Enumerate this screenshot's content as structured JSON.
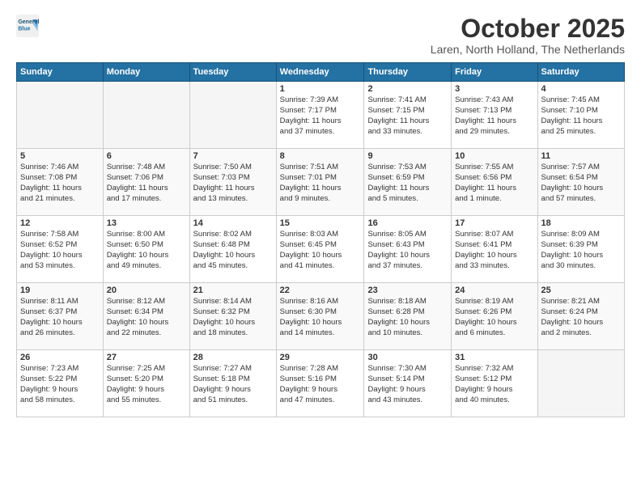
{
  "header": {
    "logo_line1": "General",
    "logo_line2": "Blue",
    "title": "October 2025",
    "subtitle": "Laren, North Holland, The Netherlands"
  },
  "days_of_week": [
    "Sunday",
    "Monday",
    "Tuesday",
    "Wednesday",
    "Thursday",
    "Friday",
    "Saturday"
  ],
  "weeks": [
    [
      {
        "day": "",
        "info": ""
      },
      {
        "day": "",
        "info": ""
      },
      {
        "day": "",
        "info": ""
      },
      {
        "day": "1",
        "info": "Sunrise: 7:39 AM\nSunset: 7:17 PM\nDaylight: 11 hours\nand 37 minutes."
      },
      {
        "day": "2",
        "info": "Sunrise: 7:41 AM\nSunset: 7:15 PM\nDaylight: 11 hours\nand 33 minutes."
      },
      {
        "day": "3",
        "info": "Sunrise: 7:43 AM\nSunset: 7:13 PM\nDaylight: 11 hours\nand 29 minutes."
      },
      {
        "day": "4",
        "info": "Sunrise: 7:45 AM\nSunset: 7:10 PM\nDaylight: 11 hours\nand 25 minutes."
      }
    ],
    [
      {
        "day": "5",
        "info": "Sunrise: 7:46 AM\nSunset: 7:08 PM\nDaylight: 11 hours\nand 21 minutes."
      },
      {
        "day": "6",
        "info": "Sunrise: 7:48 AM\nSunset: 7:06 PM\nDaylight: 11 hours\nand 17 minutes."
      },
      {
        "day": "7",
        "info": "Sunrise: 7:50 AM\nSunset: 7:03 PM\nDaylight: 11 hours\nand 13 minutes."
      },
      {
        "day": "8",
        "info": "Sunrise: 7:51 AM\nSunset: 7:01 PM\nDaylight: 11 hours\nand 9 minutes."
      },
      {
        "day": "9",
        "info": "Sunrise: 7:53 AM\nSunset: 6:59 PM\nDaylight: 11 hours\nand 5 minutes."
      },
      {
        "day": "10",
        "info": "Sunrise: 7:55 AM\nSunset: 6:56 PM\nDaylight: 11 hours\nand 1 minute."
      },
      {
        "day": "11",
        "info": "Sunrise: 7:57 AM\nSunset: 6:54 PM\nDaylight: 10 hours\nand 57 minutes."
      }
    ],
    [
      {
        "day": "12",
        "info": "Sunrise: 7:58 AM\nSunset: 6:52 PM\nDaylight: 10 hours\nand 53 minutes."
      },
      {
        "day": "13",
        "info": "Sunrise: 8:00 AM\nSunset: 6:50 PM\nDaylight: 10 hours\nand 49 minutes."
      },
      {
        "day": "14",
        "info": "Sunrise: 8:02 AM\nSunset: 6:48 PM\nDaylight: 10 hours\nand 45 minutes."
      },
      {
        "day": "15",
        "info": "Sunrise: 8:03 AM\nSunset: 6:45 PM\nDaylight: 10 hours\nand 41 minutes."
      },
      {
        "day": "16",
        "info": "Sunrise: 8:05 AM\nSunset: 6:43 PM\nDaylight: 10 hours\nand 37 minutes."
      },
      {
        "day": "17",
        "info": "Sunrise: 8:07 AM\nSunset: 6:41 PM\nDaylight: 10 hours\nand 33 minutes."
      },
      {
        "day": "18",
        "info": "Sunrise: 8:09 AM\nSunset: 6:39 PM\nDaylight: 10 hours\nand 30 minutes."
      }
    ],
    [
      {
        "day": "19",
        "info": "Sunrise: 8:11 AM\nSunset: 6:37 PM\nDaylight: 10 hours\nand 26 minutes."
      },
      {
        "day": "20",
        "info": "Sunrise: 8:12 AM\nSunset: 6:34 PM\nDaylight: 10 hours\nand 22 minutes."
      },
      {
        "day": "21",
        "info": "Sunrise: 8:14 AM\nSunset: 6:32 PM\nDaylight: 10 hours\nand 18 minutes."
      },
      {
        "day": "22",
        "info": "Sunrise: 8:16 AM\nSunset: 6:30 PM\nDaylight: 10 hours\nand 14 minutes."
      },
      {
        "day": "23",
        "info": "Sunrise: 8:18 AM\nSunset: 6:28 PM\nDaylight: 10 hours\nand 10 minutes."
      },
      {
        "day": "24",
        "info": "Sunrise: 8:19 AM\nSunset: 6:26 PM\nDaylight: 10 hours\nand 6 minutes."
      },
      {
        "day": "25",
        "info": "Sunrise: 8:21 AM\nSunset: 6:24 PM\nDaylight: 10 hours\nand 2 minutes."
      }
    ],
    [
      {
        "day": "26",
        "info": "Sunrise: 7:23 AM\nSunset: 5:22 PM\nDaylight: 9 hours\nand 58 minutes."
      },
      {
        "day": "27",
        "info": "Sunrise: 7:25 AM\nSunset: 5:20 PM\nDaylight: 9 hours\nand 55 minutes."
      },
      {
        "day": "28",
        "info": "Sunrise: 7:27 AM\nSunset: 5:18 PM\nDaylight: 9 hours\nand 51 minutes."
      },
      {
        "day": "29",
        "info": "Sunrise: 7:28 AM\nSunset: 5:16 PM\nDaylight: 9 hours\nand 47 minutes."
      },
      {
        "day": "30",
        "info": "Sunrise: 7:30 AM\nSunset: 5:14 PM\nDaylight: 9 hours\nand 43 minutes."
      },
      {
        "day": "31",
        "info": "Sunrise: 7:32 AM\nSunset: 5:12 PM\nDaylight: 9 hours\nand 40 minutes."
      },
      {
        "day": "",
        "info": ""
      }
    ]
  ]
}
